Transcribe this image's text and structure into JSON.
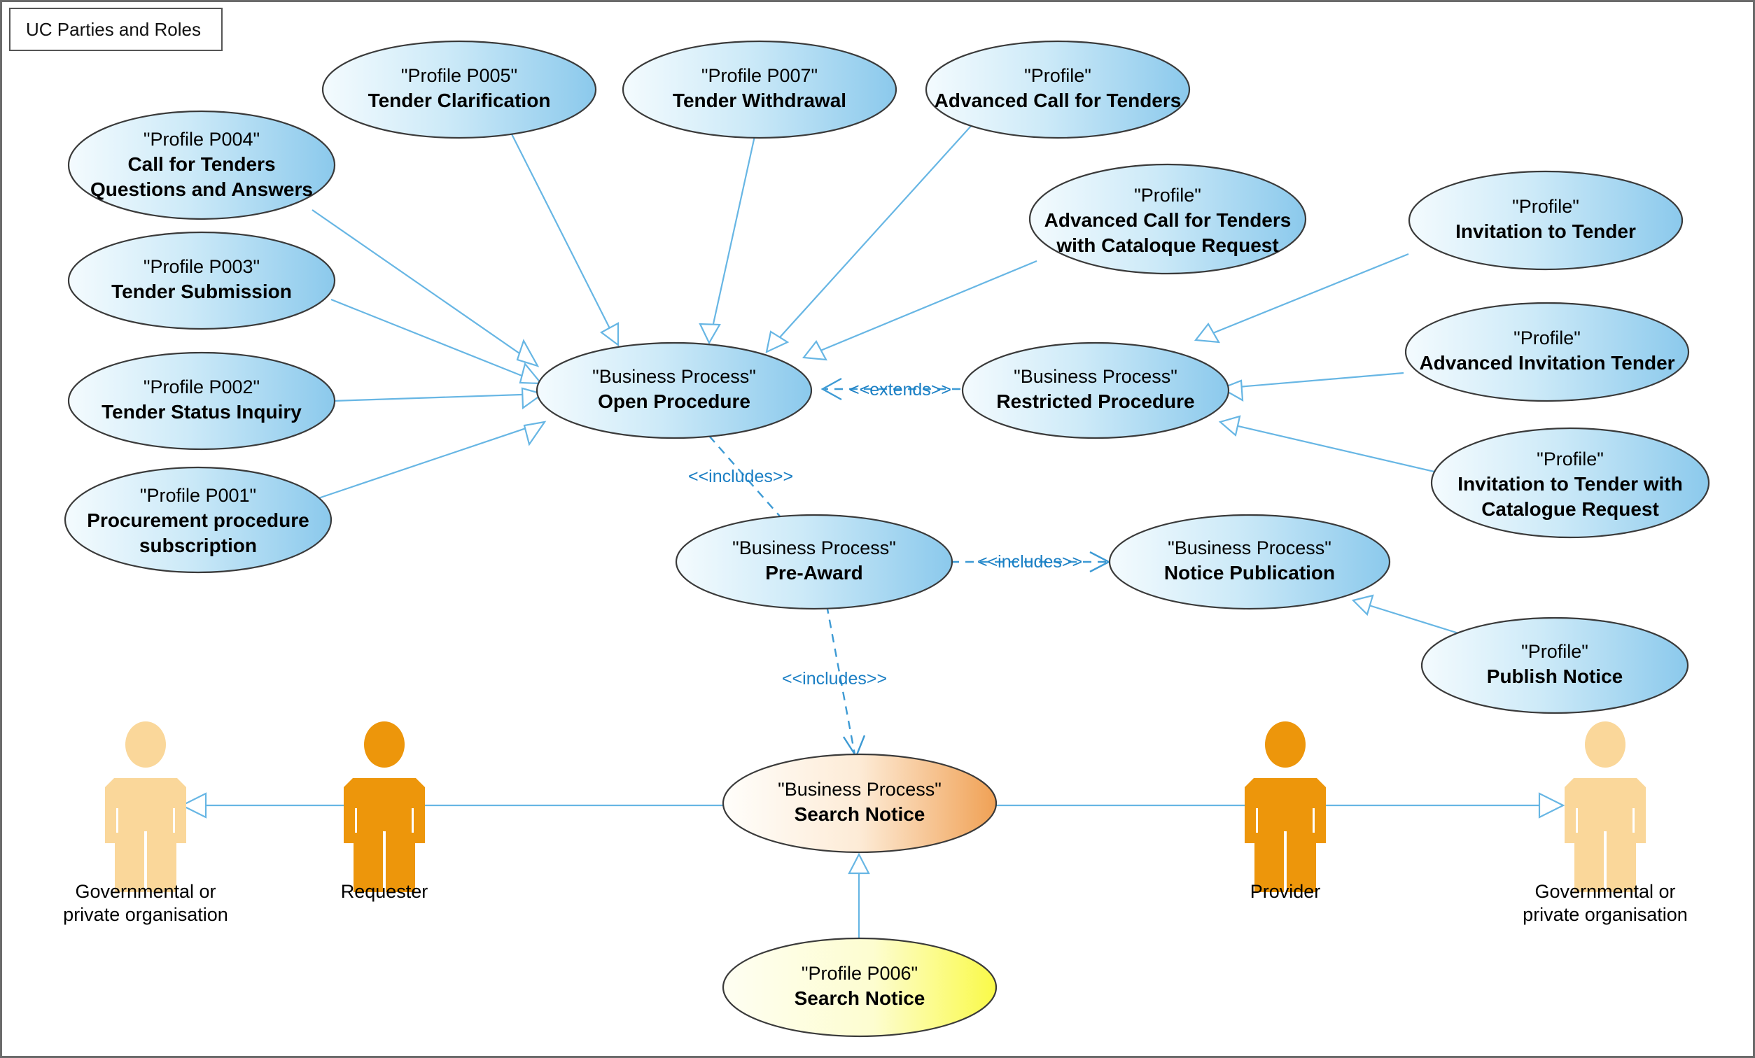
{
  "diagram": {
    "title": "UC Parties and Roles",
    "type": "uml-use-case-diagram",
    "colors": {
      "ellipse_blue_light": "#F2FAFE",
      "ellipse_blue_dark": "#8FCBEC",
      "ellipse_orange_light": "#FFFDF9",
      "ellipse_orange_dark": "#F2A254",
      "ellipse_yellow_light": "#FEFEF0",
      "ellipse_yellow_dark": "#FAFA4C",
      "actor_light": "#FAD79A",
      "actor_dark": "#ED960B",
      "edge": "#67B6E4",
      "stereotype_text": "#1B7FC4",
      "border": "#3A3A3A"
    }
  },
  "usecases": {
    "p005": {
      "line1": "\"Profile P005\"",
      "line2": "Tender Clarification"
    },
    "p007": {
      "line1": "\"Profile P007\"",
      "line2": "Tender Withdrawal"
    },
    "adv_cft": {
      "line1": "\"Profile\"",
      "line2": "Advanced Call for Tenders"
    },
    "p004": {
      "line1": "\"Profile P004\"",
      "line2": "Call for Tenders",
      "line3": "Questions and Answers"
    },
    "p003": {
      "line1": "\"Profile P003\"",
      "line2": "Tender Submission"
    },
    "p002": {
      "line1": "\"Profile P002\"",
      "line2": "Tender Status Inquiry"
    },
    "p001": {
      "line1": "\"Profile P001\"",
      "line2": "Procurement procedure",
      "line3": "subscription"
    },
    "adv_cft_cat": {
      "line1": "\"Profile\"",
      "line2": "Advanced Call for Tenders",
      "line3": "with Cataloque Request"
    },
    "inv_tender": {
      "line1": "\"Profile\"",
      "line2": "Invitation to Tender"
    },
    "adv_inv_tender": {
      "line1": "\"Profile\"",
      "line2": "Advanced Invitation Tender"
    },
    "inv_tender_cat": {
      "line1": "\"Profile\"",
      "line2": "Invitation to Tender with",
      "line3": "Catalogue Request"
    },
    "open_procedure": {
      "line1": "\"Business Process\"",
      "line2": "Open Procedure"
    },
    "restricted_procedure": {
      "line1": "\"Business Process\"",
      "line2": "Restricted Procedure"
    },
    "pre_award": {
      "line1": "\"Business Process\"",
      "line2": "Pre-Award"
    },
    "notice_publication": {
      "line1": "\"Business Process\"",
      "line2": "Notice Publication"
    },
    "publish_notice": {
      "line1": "\"Profile\"",
      "line2": "Publish Notice"
    },
    "search_notice_bp": {
      "line1": "\"Business Process\"",
      "line2": "Search Notice"
    },
    "p006": {
      "line1": "\"Profile P006\"",
      "line2": "Search Notice"
    }
  },
  "actors": {
    "gov_left": {
      "line1": "Governmental or",
      "line2": "private organisation"
    },
    "requester": {
      "line1": "Requester",
      "line2": ""
    },
    "provider": {
      "line1": "Provider",
      "line2": ""
    },
    "gov_right": {
      "line1": "Governmental or",
      "line2": "private organisation"
    }
  },
  "relationships": {
    "extends": "<<extends>>",
    "includes_1": "<<includes>>",
    "includes_2": "<<includes>>",
    "includes_3": "<<includes>>"
  }
}
